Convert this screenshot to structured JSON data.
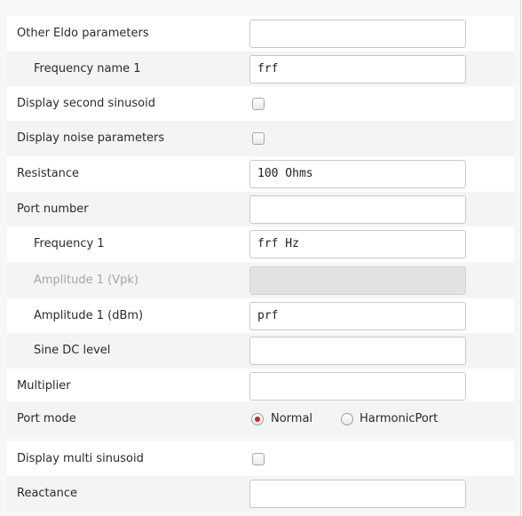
{
  "accent_color": "#d3202a",
  "rows": [
    {
      "label": "Other Eldo parameters",
      "value": ""
    },
    {
      "label": "Frequency name 1",
      "value": "frf"
    },
    {
      "label": "Display second sinusoid",
      "checked": false
    },
    {
      "label": "Display noise parameters",
      "checked": false
    },
    {
      "label": "Resistance",
      "value": "100 Ohms"
    },
    {
      "label": "Port number",
      "value": ""
    },
    {
      "label": "Frequency 1",
      "value": "frf Hz"
    },
    {
      "label": "Amplitude 1 (Vpk)",
      "value": "",
      "disabled": true
    },
    {
      "label": "Amplitude 1 (dBm)",
      "value": "prf"
    },
    {
      "label": "Sine DC level",
      "value": ""
    },
    {
      "label": "Multiplier",
      "value": ""
    },
    {
      "label": "Port mode",
      "options": [
        "Normal",
        "HarmonicPort"
      ],
      "selected": "Normal"
    },
    {
      "label": "Display multi sinusoid",
      "checked": false
    },
    {
      "label": "Reactance",
      "value": ""
    }
  ]
}
